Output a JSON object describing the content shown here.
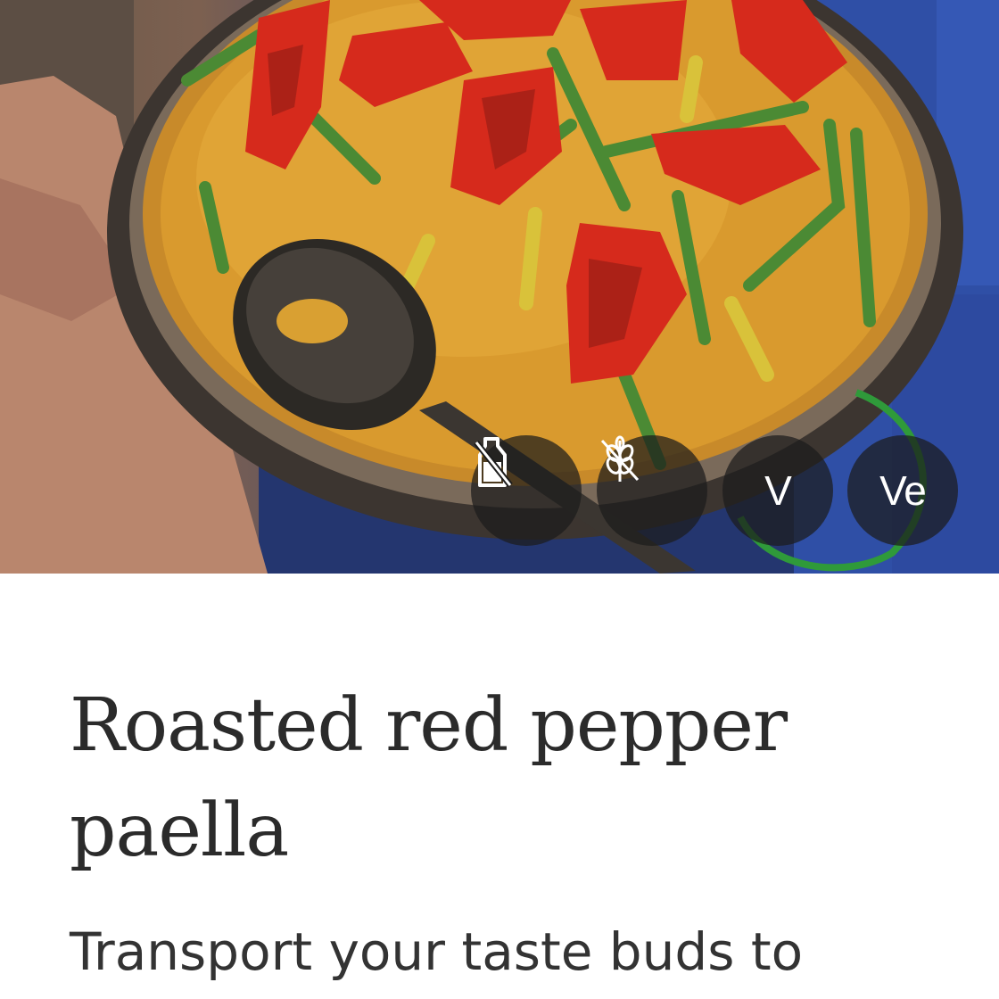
{
  "recipe": {
    "title": "Roasted red pepper paella",
    "description": "Transport your taste buds to"
  },
  "diet_badges": [
    {
      "icon": "dairy-free-icon",
      "label": ""
    },
    {
      "icon": "gluten-free-icon",
      "label": ""
    },
    {
      "icon": "vegetarian-icon",
      "label": "V"
    },
    {
      "icon": "vegan-icon",
      "label": "Ve"
    }
  ],
  "colors": {
    "badge_background": "#1c1c1c",
    "title_text": "#2b2b2b",
    "body_text": "#333333"
  }
}
